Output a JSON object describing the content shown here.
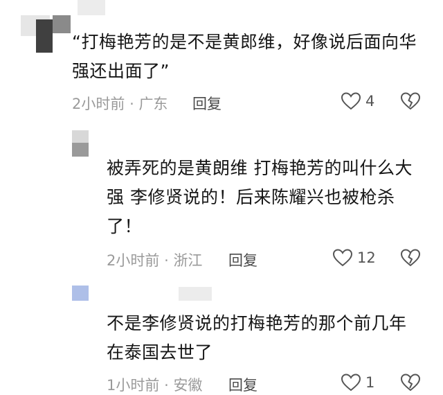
{
  "comments": [
    {
      "text_line1": "“打梅艳芳的是不是黄郎维，好像说后面向华",
      "text_line2": "强还出面了”",
      "time": "2小时前",
      "separator": "·",
      "location": "广东",
      "reply_label": "回复",
      "likes": "4"
    },
    {
      "text_line1": "被弄死的是黄朗维 打梅艳芳的叫什么大",
      "text_line2": "强 李修贤说的！后来陈耀兴也被枪杀",
      "text_line3": "了！",
      "time": "2小时前",
      "separator": "·",
      "location": "浙江",
      "reply_label": "回复",
      "likes": "12"
    },
    {
      "text_line1": "不是李修贤说的打梅艳芳的那个前几年",
      "text_line2": "在泰国去世了",
      "time": "1小时前",
      "separator": "·",
      "location": "安徽",
      "reply_label": "回复",
      "likes": "1"
    }
  ],
  "icons": {
    "like": "heart-outline-icon",
    "dislike": "broken-heart-icon"
  },
  "colors": {
    "avatar_blur_dark": "#4a4a4a",
    "avatar_blur_light": "#d9d9d9",
    "avatar_blue": "#aebfe8",
    "meta_gray": "#9a9a9a"
  }
}
